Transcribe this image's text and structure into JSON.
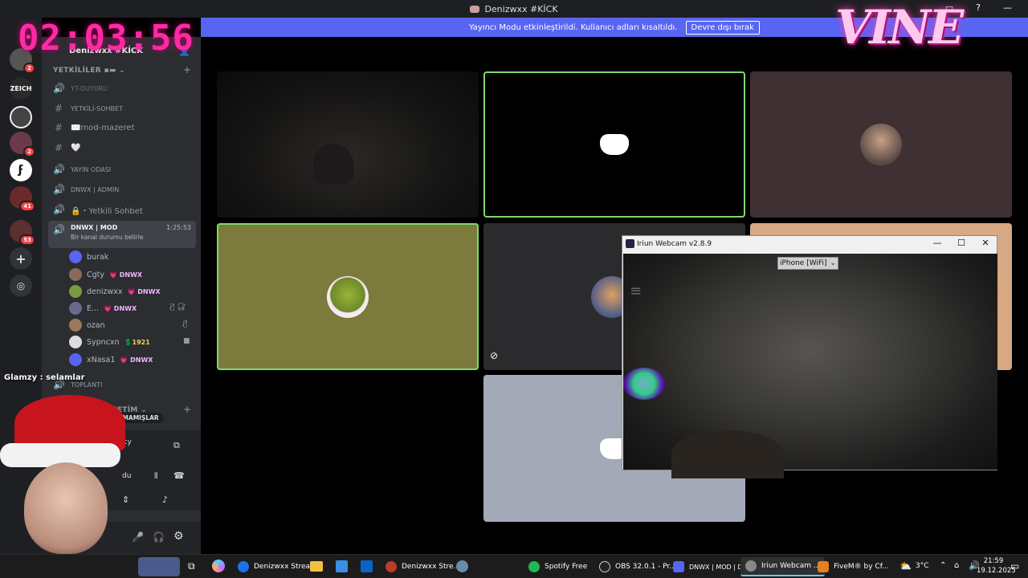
{
  "window_title": "Denizwxx #KİCK",
  "streamer_mode": {
    "message": "Yayıncı Modu etkinleştirildi. Kullanıcı adları kısaltıldı.",
    "button": "Devre dışı bırak"
  },
  "overlay": {
    "timer": "02:03:56",
    "brand_logo_text": "VINE",
    "chat_message": "Glamzy : selamlar"
  },
  "server": {
    "name": "Denizwxx #KİCK"
  },
  "rail": {
    "servers": [
      {
        "name": "server-1",
        "badge": "2",
        "color": "#444"
      },
      {
        "name": "ZEICH",
        "badge": "",
        "color": "#222"
      },
      {
        "name": "server-3",
        "badge": "",
        "color": "#333"
      },
      {
        "name": "server-4",
        "badge": "2",
        "color": "#4a2a3a"
      },
      {
        "name": "server-5",
        "badge": "",
        "color": "#fff"
      },
      {
        "name": "server-6",
        "badge": "41",
        "color": "#5a2a2a"
      },
      {
        "name": "server-7",
        "badge": "53",
        "color": "#3a2a2a"
      }
    ]
  },
  "channels": {
    "category_1": "YETKİLİLER ▪▬",
    "items": [
      {
        "label": "YT-DUYURU",
        "icon": "announcement-icon"
      },
      {
        "label": "YETKİLİ-SOHBET",
        "icon": "hash-icon"
      },
      {
        "label": "✉️mod-mazeret",
        "icon": "hash-icon"
      },
      {
        "label": "🤍",
        "icon": "hash-icon"
      },
      {
        "label": "YAYIN ODASI",
        "icon": "voice-icon"
      },
      {
        "label": "DNWX | ADMİN",
        "icon": "voice-icon"
      },
      {
        "label": "🔒・Yetkili Sohbet",
        "icon": "voice-icon"
      }
    ],
    "active_voice": {
      "label": "DNWX | MOD",
      "time": "1:25:53",
      "status": "Bir kanal durumu belirle"
    },
    "users": [
      {
        "name": "burak",
        "tag": "",
        "color": "#5865f2"
      },
      {
        "name": "Cgty",
        "tag": "💗 DNWX",
        "color": "#8a6a5a"
      },
      {
        "name": "denizwxx",
        "tag": "💗 DNWX",
        "color": "#7a9a40"
      },
      {
        "name": "E...",
        "tag": "💗 DNWX",
        "color": "#6a6a8a"
      },
      {
        "name": "ozan",
        "tag": "",
        "color": "#9a7a5a"
      },
      {
        "name": "Sypncxn",
        "tag": "💲1921",
        "color": "#ddd"
      },
      {
        "name": "xNasa1",
        "tag": "💗 DNWX",
        "color": "#5865f2"
      }
    ],
    "toplanti": "TOPLANTI",
    "category_2": "& YÖNETİM",
    "unread_pill": "OKUNMAMIŞLAR",
    "voice_panel": {
      "line1": "acy",
      "line2": "du"
    }
  },
  "webcam_window": {
    "title": "Iriun Webcam v2.8.9",
    "device": "iPhone [WiFi]"
  },
  "taskbar": {
    "items": [
      {
        "label": "Denizwxx Strea...",
        "color": "#1a73e8"
      },
      {
        "label": "Denizwxx Stre...",
        "color": "#c0392b"
      },
      {
        "label": "Spotify Free",
        "color": "#1db954"
      },
      {
        "label": "OBS 32.0.1 - Pr...",
        "color": "#333"
      },
      {
        "label": "DNWX | MOD | D...",
        "color": "#5865f2"
      },
      {
        "label": "Iriun Webcam ...",
        "color": "#888"
      },
      {
        "label": "FiveM® by Cf...",
        "color": "#e67e22"
      }
    ],
    "weather": "3°C",
    "time": "21:59",
    "date": "19.12.2025"
  }
}
